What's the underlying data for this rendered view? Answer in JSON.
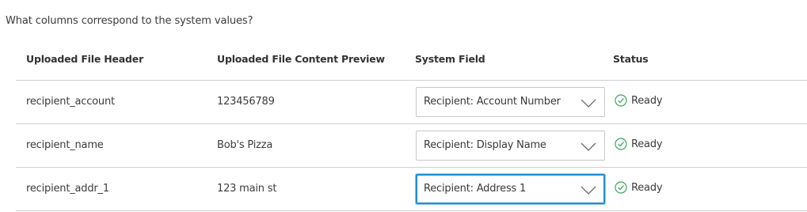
{
  "question": "What columns correspond to the system values?",
  "headers": {
    "file_header": "Uploaded File Header",
    "content_preview": "Uploaded File Content Preview",
    "system_field": "System Field",
    "status": "Status"
  },
  "rows": [
    {
      "file_header": "recipient_account",
      "preview": "123456789",
      "system_field": "Recipient: Account Number",
      "status": "Ready"
    },
    {
      "file_header": "recipient_name",
      "preview": "Bob's Pizza",
      "system_field": "Recipient: Display Name",
      "status": "Ready"
    },
    {
      "file_header": "recipient_addr_1",
      "preview": "123 main st",
      "system_field": "Recipient: Address 1",
      "status": "Ready"
    }
  ],
  "colors": {
    "ready": "#3aa65a",
    "focus": "#1e8fd6",
    "border": "#cfcfcf"
  },
  "icons": {
    "status_ready": "check-circle-icon",
    "dropdown": "chevron-down-icon"
  }
}
